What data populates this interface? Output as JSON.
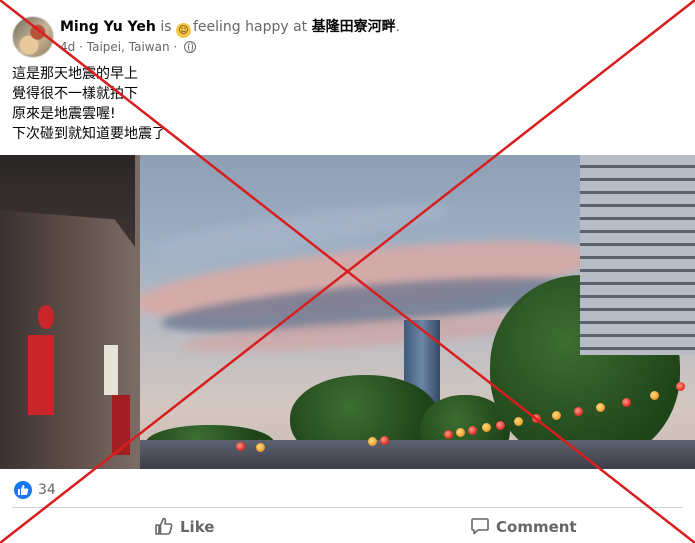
{
  "post": {
    "author": "Ming Yu Yeh",
    "is_word": "is",
    "feeling_text": "feeling happy at",
    "location": "基隆田寮河畔",
    "period": ".",
    "time": "4d",
    "place": "Taipei, Taiwan",
    "separator": "·",
    "audience_icon": "globe-icon",
    "feeling_icon": "smiling-face-icon",
    "text_lines": [
      "這是那天地震的早上",
      "覺得很不一樣就拍下",
      "原來是地震雲喔!",
      "下次碰到就知道要地震了"
    ]
  },
  "reactions": {
    "icon": "thumbs-up-icon",
    "count": "34"
  },
  "actions": {
    "like_label": "Like",
    "comment_label": "Comment"
  },
  "overlay": {
    "mark": "red-x",
    "color": "#d81e1e"
  },
  "colors": {
    "like_blue": "#1877f2",
    "muted_text": "#65676b"
  }
}
